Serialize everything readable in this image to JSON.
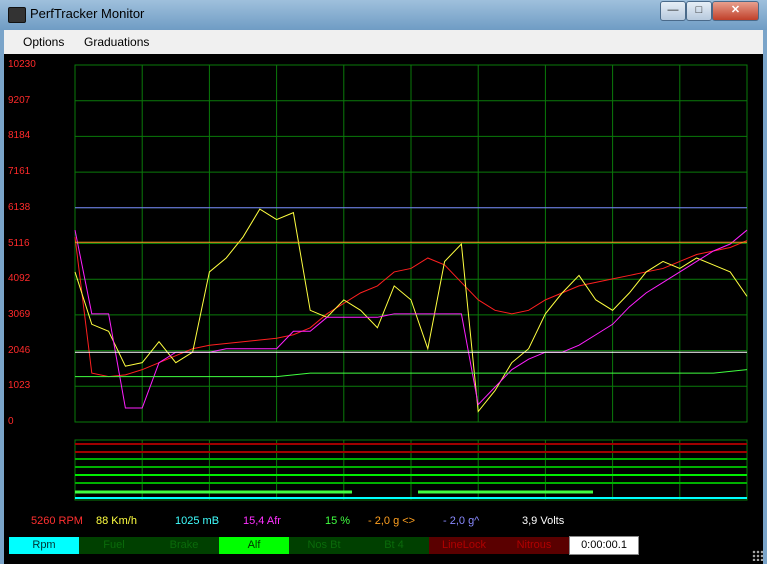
{
  "window": {
    "title": "PerfTracker Monitor",
    "minimize_icon": "minimize-icon",
    "maximize_icon": "maximize-icon",
    "close_icon": "close-icon"
  },
  "menu": {
    "items": [
      "Options",
      "Graduations"
    ]
  },
  "axis": {
    "ticks": [
      "10230",
      "9207",
      "8184",
      "7161",
      "6138",
      "5116",
      "4092",
      "3069",
      "2046",
      "1023",
      "0"
    ]
  },
  "readouts": {
    "rpm": "5260 RPM",
    "speed": "88 Km/h",
    "pressure": "1025 mB",
    "afr": "15,4 Afr",
    "percent": "15 %",
    "g_lateral": "-   2,0 g <>",
    "g_long": "-   2,0 g^",
    "volts": "3,9 Volts"
  },
  "channels": [
    {
      "label": "Rpm",
      "bg": "#00ffff",
      "fg": "#003333"
    },
    {
      "label": "Fuel",
      "bg": "#004000",
      "fg": "#0a6a0a"
    },
    {
      "label": "Brake",
      "bg": "#004000",
      "fg": "#0a6a0a"
    },
    {
      "label": "Alf",
      "bg": "#00ff00",
      "fg": "#003300"
    },
    {
      "label": "Nos Bt",
      "bg": "#004000",
      "fg": "#0a6a0a"
    },
    {
      "label": "Bt 4",
      "bg": "#004000",
      "fg": "#0a6a0a"
    },
    {
      "label": "LineLock",
      "bg": "#5a0000",
      "fg": "#b00000"
    },
    {
      "label": "Nitrous",
      "bg": "#5a0000",
      "fg": "#b00000"
    }
  ],
  "timer": "0:00:00.1",
  "colors": {
    "grid": "#0a7a0a",
    "rpm": "#ff2020",
    "speed": "#ffff40",
    "afr": "#ff20ff",
    "boost": "#a040ff",
    "percent": "#40ff40",
    "ref_blue": "#7a7aff",
    "ref_orange": "#ffa020",
    "ref_white": "#ffffff",
    "axis_text": "#ff2a2a"
  },
  "chart_data": {
    "type": "line",
    "ylim": [
      0,
      10230
    ],
    "x": [
      0,
      1,
      2,
      3,
      4,
      5,
      6,
      7,
      8,
      9,
      10,
      11,
      12,
      13,
      14,
      15,
      16,
      17,
      18,
      19,
      20,
      21,
      22,
      23,
      24,
      25,
      26,
      27,
      28,
      29,
      30,
      31,
      32,
      33,
      34,
      35,
      36,
      37,
      38,
      39,
      40
    ],
    "series": [
      {
        "name": "rpm",
        "values": [
          5300,
          1400,
          1300,
          1350,
          1500,
          1700,
          1900,
          2100,
          2200,
          2250,
          2300,
          2350,
          2400,
          2500,
          2700,
          3100,
          3400,
          3700,
          3900,
          4300,
          4400,
          4700,
          4500,
          4000,
          3500,
          3200,
          3100,
          3200,
          3500,
          3700,
          3900,
          4000,
          4100,
          4200,
          4300,
          4400,
          4600,
          4800,
          4900,
          5000,
          5200
        ]
      },
      {
        "name": "speed",
        "values": [
          4300,
          2800,
          2600,
          1600,
          1700,
          2300,
          1700,
          2000,
          4300,
          4700,
          5300,
          6100,
          5800,
          6000,
          3200,
          3000,
          3500,
          3200,
          2700,
          3900,
          3500,
          2100,
          4600,
          5100,
          300,
          900,
          1700,
          2100,
          3100,
          3700,
          4200,
          3500,
          3200,
          3700,
          4300,
          4600,
          4400,
          4700,
          4500,
          4300,
          3600
        ]
      },
      {
        "name": "afr",
        "values": [
          5500,
          3100,
          3100,
          400,
          400,
          1700,
          2000,
          2000,
          2000,
          2100,
          2100,
          2100,
          2100,
          2600,
          2600,
          3000,
          3000,
          3000,
          3000,
          3100,
          3100,
          3100,
          3100,
          3100,
          500,
          1000,
          1500,
          1800,
          2000,
          2000,
          2200,
          2500,
          2800,
          3300,
          3700,
          4000,
          4300,
          4600,
          4900,
          5100,
          5500
        ]
      },
      {
        "name": "percent",
        "values": [
          1300,
          1300,
          1300,
          1300,
          1300,
          1300,
          1300,
          1300,
          1300,
          1300,
          1300,
          1300,
          1300,
          1350,
          1400,
          1400,
          1400,
          1400,
          1400,
          1400,
          1400,
          1400,
          1400,
          1400,
          1400,
          1400,
          1400,
          1400,
          1400,
          1400,
          1400,
          1400,
          1400,
          1400,
          1400,
          1400,
          1400,
          1400,
          1400,
          1450,
          1500
        ]
      },
      {
        "name": "reference-blue",
        "values": [
          6138,
          6138
        ]
      },
      {
        "name": "reference-orange",
        "values": [
          5150,
          5150
        ]
      },
      {
        "name": "reference-white",
        "values": [
          2000,
          2000
        ]
      }
    ]
  }
}
